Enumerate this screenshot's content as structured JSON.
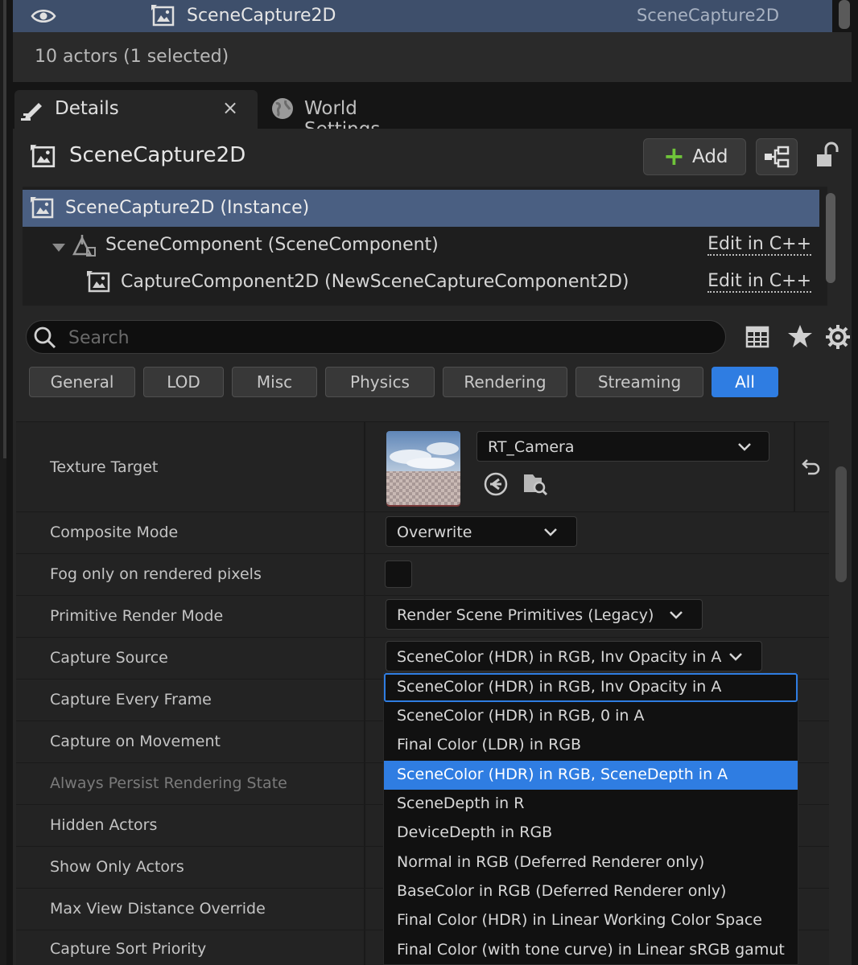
{
  "outliner": {
    "selected_row": {
      "name": "SceneCapture2D",
      "type": "SceneCapture2D"
    },
    "footer": "10 actors (1 selected)"
  },
  "tabs": [
    {
      "label": "Details",
      "icon": "pencil-icon",
      "active": true,
      "close": "×"
    },
    {
      "label": "World Settings",
      "icon": "globe-icon",
      "active": false
    }
  ],
  "details": {
    "actor_name": "SceneCapture2D",
    "add_label": "Add",
    "components": [
      {
        "label": "SceneCapture2D (Instance)",
        "edit": ""
      },
      {
        "label": "SceneComponent (SceneComponent)",
        "edit": "Edit in C++"
      },
      {
        "label": "CaptureComponent2D (NewSceneCaptureComponent2D)",
        "edit": "Edit in C++"
      }
    ],
    "search_placeholder": "Search",
    "filters": [
      "General",
      "LOD",
      "Misc",
      "Physics",
      "Rendering",
      "Streaming",
      "All"
    ],
    "active_filter": "All",
    "properties": {
      "texture_target": {
        "label": "Texture Target",
        "value": "RT_Camera"
      },
      "composite_mode": {
        "label": "Composite Mode",
        "value": "Overwrite"
      },
      "fog_only": {
        "label": "Fog only on rendered pixels",
        "checked": false
      },
      "primitive_render_mode": {
        "label": "Primitive Render Mode",
        "value": "Render Scene Primitives (Legacy)"
      },
      "capture_source": {
        "label": "Capture Source",
        "value": "SceneColor (HDR) in RGB, Inv Opacity in A"
      },
      "capture_every_frame": {
        "label": "Capture Every Frame"
      },
      "capture_on_movement": {
        "label": "Capture on Movement"
      },
      "always_persist": {
        "label": "Always Persist Rendering State"
      },
      "hidden_actors": {
        "label": "Hidden Actors"
      },
      "show_only_actors": {
        "label": "Show Only Actors"
      },
      "max_view_distance": {
        "label": "Max View Distance Override"
      },
      "capture_sort_priority": {
        "label": "Capture Sort Priority"
      }
    }
  },
  "dropdown": {
    "options": [
      "SceneColor (HDR) in RGB, Inv Opacity in A",
      "SceneColor (HDR) in RGB, 0 in A",
      "Final Color (LDR) in RGB",
      "SceneColor (HDR) in RGB, SceneDepth in A",
      "SceneDepth in R",
      "DeviceDepth in RGB",
      "Normal in RGB (Deferred Renderer only)",
      "BaseColor in RGB (Deferred Renderer only)",
      "Final Color (HDR) in Linear Working Color Space",
      "Final Color (with tone curve) in Linear sRGB gamut"
    ],
    "focused_index": 0,
    "highlighted_index": 3
  },
  "colors": {
    "accent": "#2f7de2",
    "selection": "#4a5f82",
    "add_green": "#6fc43a"
  }
}
